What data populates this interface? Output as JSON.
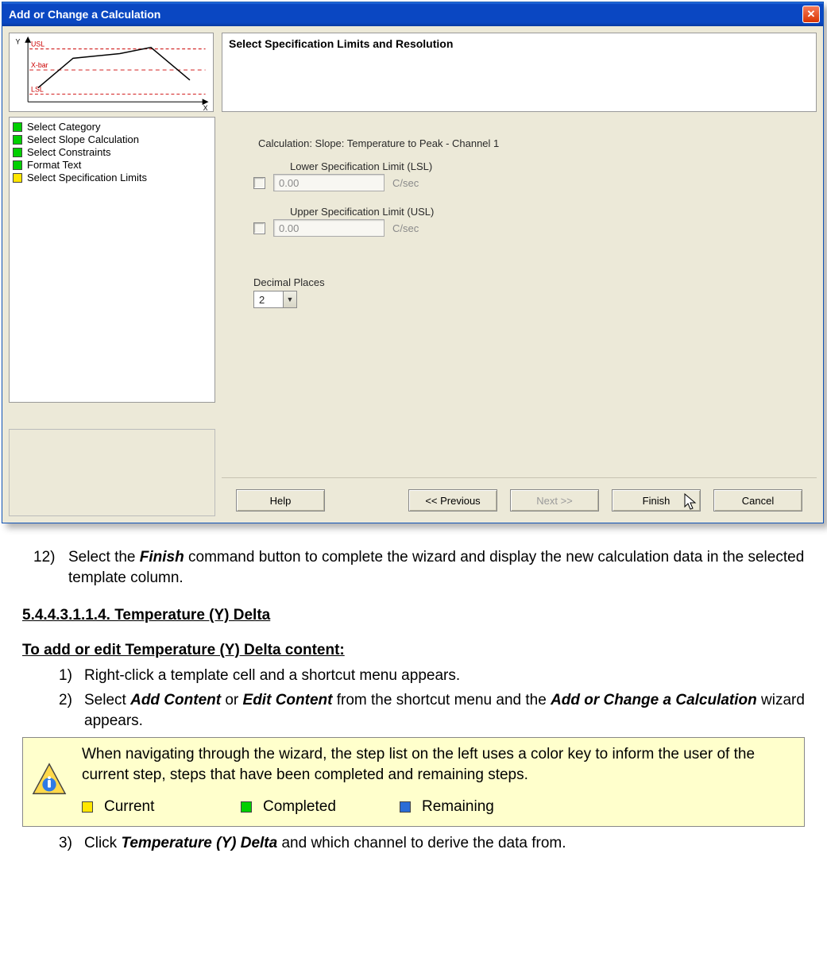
{
  "dialog": {
    "title": "Add or Change a Calculation",
    "header": "Select Specification Limits and Resolution",
    "calculation_line": "Calculation: Slope: Temperature to Peak - Channel 1",
    "lsl": {
      "label": "Lower Specification Limit (LSL)",
      "value": "0.00",
      "unit": "C/sec"
    },
    "usl": {
      "label": "Upper Specification Limit (USL)",
      "value": "0.00",
      "unit": "C/sec"
    },
    "decimal": {
      "label": "Decimal Places",
      "value": "2"
    },
    "steps": [
      {
        "label": "Select Category",
        "state": "green"
      },
      {
        "label": "Select Slope Calculation",
        "state": "green"
      },
      {
        "label": "Select Constraints",
        "state": "green"
      },
      {
        "label": "Format Text",
        "state": "green"
      },
      {
        "label": "Select Specification Limits",
        "state": "yellow"
      }
    ],
    "buttons": {
      "help": "Help",
      "previous": "<< Previous",
      "next": "Next >>",
      "finish": "Finish",
      "cancel": "Cancel"
    },
    "chart_labels": {
      "y": "Y",
      "x": "X",
      "usl": "USL",
      "xbar": "X-bar",
      "lsl": "LSL"
    }
  },
  "doc": {
    "step12_num": "12)",
    "step12_lead": "Select the ",
    "step12_bold": "Finish",
    "step12_tail": " command button to complete the wizard and display the new calculation data in the selected template column.",
    "section": "5.4.4.3.1.1.4. Temperature (Y) Delta",
    "subhead": "To add or edit Temperature (Y) Delta content:",
    "s1_num": "1)",
    "s1_text": "Right-click a template cell and a shortcut menu appears.",
    "s2_num": "2)",
    "s2_a": "Select ",
    "s2_b1": "Add Content",
    "s2_c": " or ",
    "s2_b2": "Edit Content",
    "s2_d": " from the shortcut menu and the ",
    "s2_b3": "Add or Change a Calculation",
    "s2_e": " wizard appears.",
    "note_text": "When navigating through the wizard, the step list on the left uses a color key to inform the user of the current step, steps that have been completed and remaining steps.",
    "legend": {
      "current": "Current",
      "completed": "Completed",
      "remaining": "Remaining"
    },
    "s3_num": "3)",
    "s3_a": "Click ",
    "s3_b": "Temperature (Y) Delta",
    "s3_c": " and which channel to derive the data from."
  }
}
